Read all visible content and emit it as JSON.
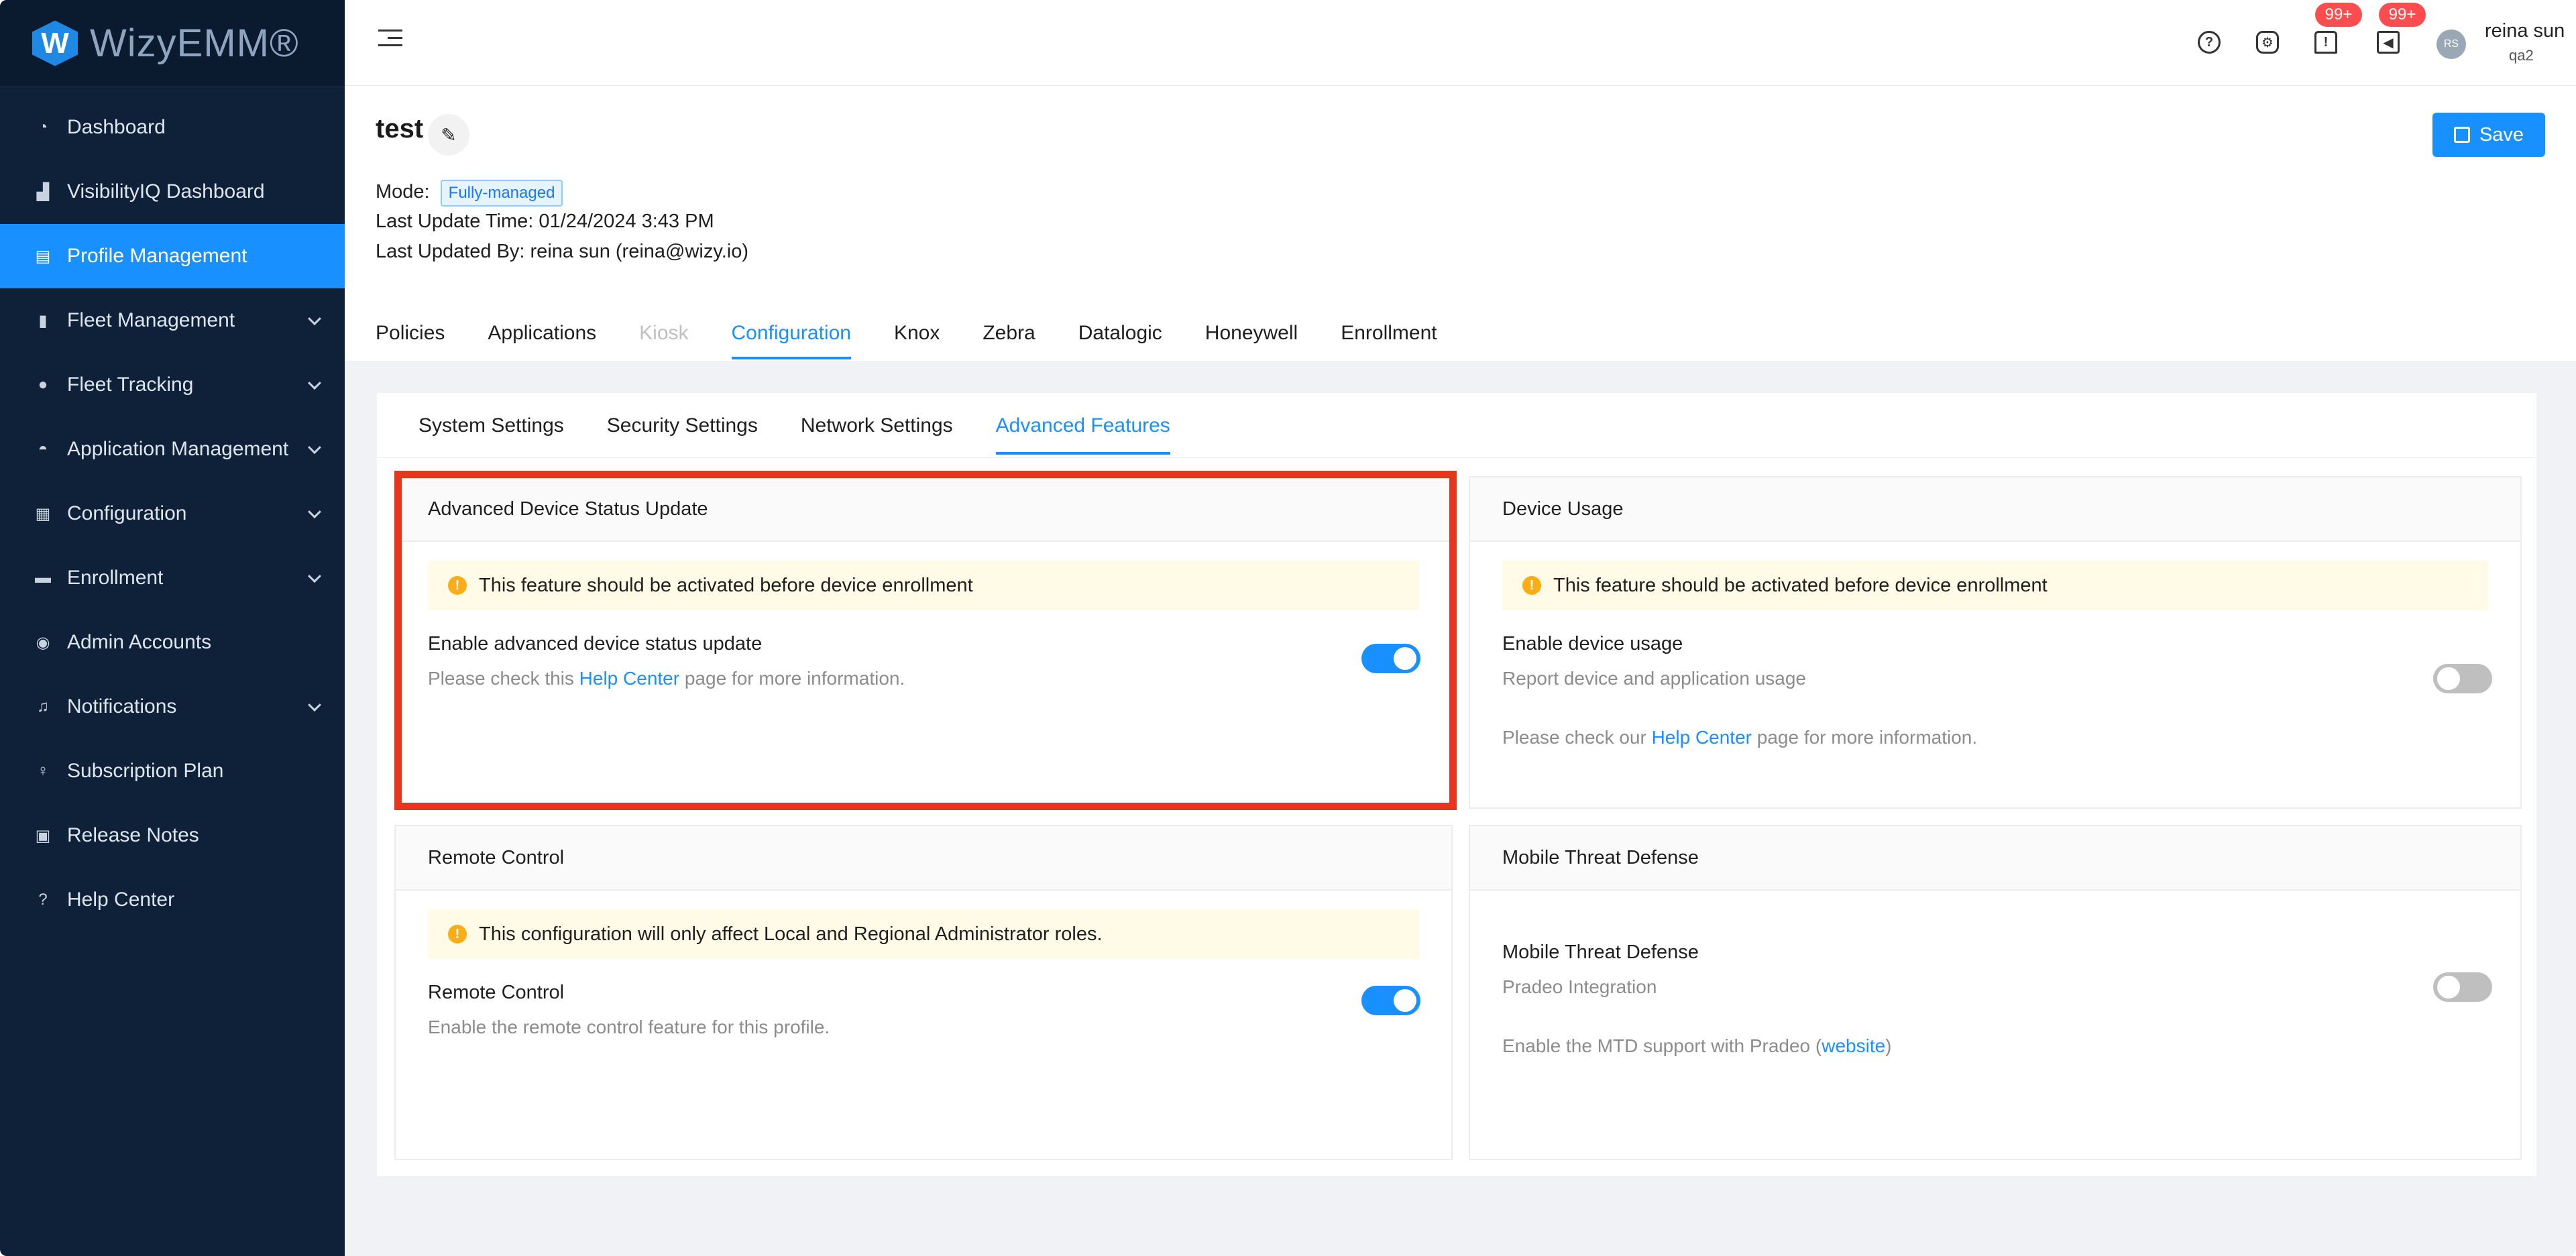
{
  "app": {
    "logo_letter": "W",
    "logo_text": "WizyEMM®"
  },
  "sidebar": {
    "items": [
      {
        "label": "Dashboard",
        "icon": "pie-chart-icon"
      },
      {
        "label": "VisibilityIQ Dashboard",
        "icon": "bar-chart-icon"
      },
      {
        "label": "Profile Management",
        "icon": "file-icon",
        "active": true
      },
      {
        "label": "Fleet Management",
        "icon": "tablet-icon",
        "expandable": true
      },
      {
        "label": "Fleet Tracking",
        "icon": "location-icon",
        "expandable": true
      },
      {
        "label": "Application Management",
        "icon": "android-icon",
        "expandable": true
      },
      {
        "label": "Configuration",
        "icon": "config-icon",
        "expandable": true
      },
      {
        "label": "Enrollment",
        "icon": "enroll-icon",
        "expandable": true
      },
      {
        "label": "Admin Accounts",
        "icon": "user-icon"
      },
      {
        "label": "Notifications",
        "icon": "bell-icon",
        "expandable": true
      },
      {
        "label": "Subscription Plan",
        "icon": "bulb-icon"
      },
      {
        "label": "Release Notes",
        "icon": "calendar-icon"
      },
      {
        "label": "Help Center",
        "icon": "question-icon"
      }
    ]
  },
  "header": {
    "alerts_badge": "99+",
    "announcements_badge": "99+",
    "user_initials": "RS",
    "user_name": "reina sun",
    "user_org": "qa2"
  },
  "profile": {
    "title": "test",
    "save_label": "Save",
    "mode_label": "Mode:",
    "mode_value": "Fully-managed",
    "last_update": "Last Update Time: 01/24/2024 3:43 PM",
    "last_updated_by": "Last Updated By: reina sun (reina@wizy.io)"
  },
  "main_tabs": [
    {
      "label": "Policies"
    },
    {
      "label": "Applications"
    },
    {
      "label": "Kiosk",
      "disabled": true
    },
    {
      "label": "Configuration",
      "active": true
    },
    {
      "label": "Knox"
    },
    {
      "label": "Zebra"
    },
    {
      "label": "Datalogic"
    },
    {
      "label": "Honeywell"
    },
    {
      "label": "Enrollment"
    }
  ],
  "sub_tabs": [
    {
      "label": "System Settings"
    },
    {
      "label": "Security Settings"
    },
    {
      "label": "Network Settings"
    },
    {
      "label": "Advanced Features",
      "active": true
    }
  ],
  "panels": {
    "adv_status": {
      "title": "Advanced Device Status Update",
      "alert": "This feature should be activated before device enrollment",
      "option_title": "Enable advanced device status update",
      "desc_pre": "Please check this ",
      "desc_link": "Help Center",
      "desc_post": " page for more information.",
      "enabled": true
    },
    "device_usage": {
      "title": "Device Usage",
      "alert": "This feature should be activated before device enrollment",
      "option_title": "Enable device usage",
      "option_desc": "Report device and application usage",
      "help_pre": "Please check our ",
      "help_link": "Help Center",
      "help_post": " page for more information.",
      "enabled": false
    },
    "remote_control": {
      "title": "Remote Control",
      "alert": "This configuration will only affect Local and Regional Administrator roles.",
      "option_title": "Remote Control",
      "option_desc": "Enable the remote control feature for this profile.",
      "enabled": true
    },
    "mtd": {
      "title": "Mobile Threat Defense",
      "option_title": "Mobile Threat Defense",
      "option_desc": "Pradeo Integration",
      "support_pre": "Enable the MTD support with Pradeo (",
      "support_link": "website",
      "support_post": ")",
      "enabled": false
    }
  },
  "colors": {
    "accent": "#1890ff",
    "sidebar_bg": "#0e2138",
    "highlight": "#e8351e",
    "warning": "#faad14"
  }
}
